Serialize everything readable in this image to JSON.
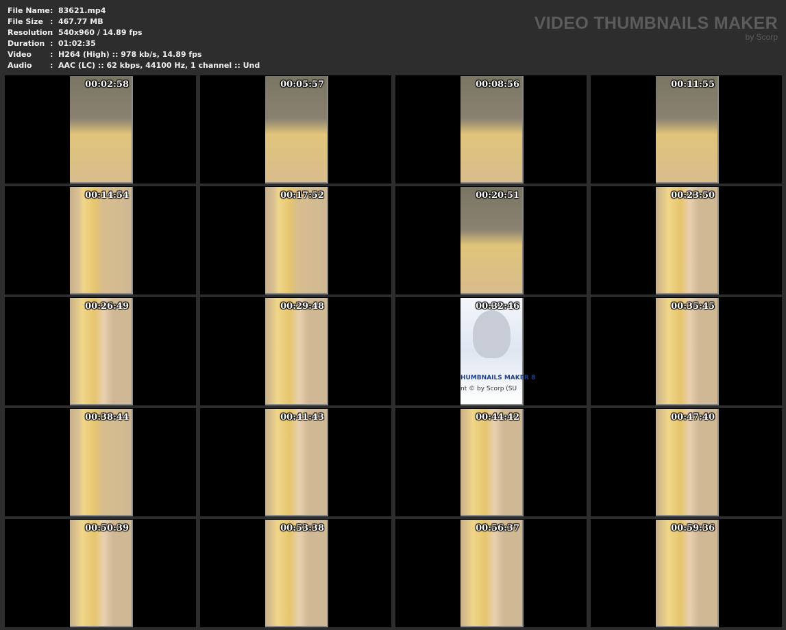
{
  "info": [
    {
      "key": "File Name",
      "value": "83621.mp4"
    },
    {
      "key": "File Size",
      "value": "467.77 MB"
    },
    {
      "key": "Resolution",
      "value": "540x960 / 14.89 fps"
    },
    {
      "key": "Duration",
      "value": "01:02:35"
    },
    {
      "key": "Video",
      "value": "H264 (High) :: 978 kb/s, 14.89 fps"
    },
    {
      "key": "Audio",
      "value": "AAC (LC) :: 62 kbps, 44100 Hz, 1 channel :: Und"
    }
  ],
  "separator": ":",
  "logo": {
    "title": "VIDEO THUMBNAILS MAKER",
    "byline": "by Scorp"
  },
  "thumbnails": [
    {
      "time": "00:02:58",
      "style": "v2"
    },
    {
      "time": "00:05:57",
      "style": "v2"
    },
    {
      "time": "00:08:56",
      "style": "v2"
    },
    {
      "time": "00:11:55",
      "style": "v2"
    },
    {
      "time": "00:14:54",
      "style": ""
    },
    {
      "time": "00:17:52",
      "style": ""
    },
    {
      "time": "00:20:51",
      "style": "v2"
    },
    {
      "time": "00:23:50",
      "style": "v3"
    },
    {
      "time": "00:26:49",
      "style": "v3"
    },
    {
      "time": "00:29:48",
      "style": "v3"
    },
    {
      "time": "00:32:46",
      "style": "logoimg"
    },
    {
      "time": "00:35:45",
      "style": "v3"
    },
    {
      "time": "00:38:44",
      "style": ""
    },
    {
      "time": "00:41:43",
      "style": "v3"
    },
    {
      "time": "00:44:42",
      "style": "v3"
    },
    {
      "time": "00:47:40",
      "style": "v3"
    },
    {
      "time": "00:50:39",
      "style": "v3"
    },
    {
      "time": "00:53:38",
      "style": "v3"
    },
    {
      "time": "00:56:37",
      "style": "v3"
    },
    {
      "time": "00:59:36",
      "style": "v3"
    }
  ],
  "embedded_logo": {
    "line1": "HUMBNAILS MAKER 8",
    "line2": "nt © by Scorp (SU"
  }
}
